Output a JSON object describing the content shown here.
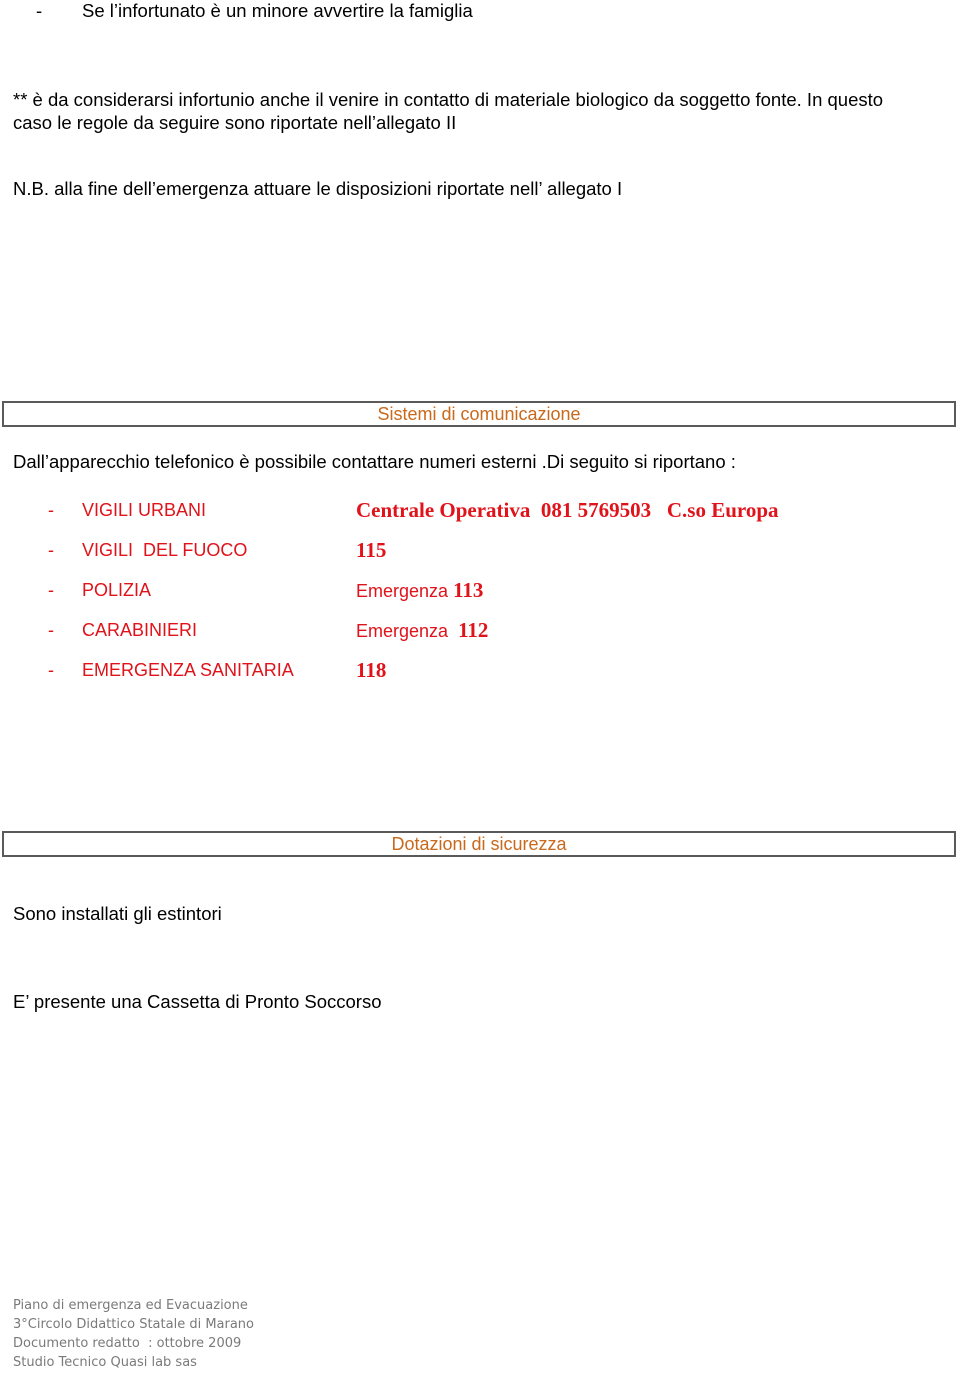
{
  "top_bullet": {
    "dash": "-",
    "text": "Se l’infortunato è un minore avvertire la famiglia"
  },
  "note_biological": {
    "line1": "** è da considerarsi infortunio anche il venire in contatto di materiale biologico da soggetto fonte. In questo",
    "line2": "caso le regole da seguire sono riportate nell’allegato II"
  },
  "nb_note": "N.B. alla fine dell’emergenza attuare le disposizioni riportate nell’ allegato I",
  "section_communication": {
    "title": "Sistemi di comunicazione",
    "intro": "Dall’apparecchio telefonico è possibile contattare numeri esterni .Di seguito si riportano  :",
    "contacts": [
      {
        "dash": "-",
        "name": "VIGILI URBANI",
        "prefix": "",
        "number": "Centrale Operativa  081 5769503   C.so Europa"
      },
      {
        "dash": "-",
        "name": "VIGILI  DEL FUOCO",
        "prefix": "",
        "number": "115"
      },
      {
        "dash": "-",
        "name": "POLIZIA",
        "prefix": "Emergenza ",
        "number": "113"
      },
      {
        "dash": "-",
        "name": "CARABINIERI",
        "prefix": "Emergenza  ",
        "number": "112"
      },
      {
        "dash": "-",
        "name": "EMERGENZA SANITARIA",
        "prefix": "",
        "number": "118"
      }
    ]
  },
  "section_safety": {
    "title": "Dotazioni di sicurezza",
    "items": [
      "Sono installati gli estintori",
      "E’ presente una Cassetta di Pronto Soccorso"
    ]
  },
  "footer": {
    "lines": [
      "Piano di emergenza ed Evacuazione",
      "3°Circolo Didattico Statale di Marano",
      "Documento redatto  : ottobre 2009",
      "Studio Tecnico Quasi lab sas"
    ]
  },
  "colors": {
    "section_title": "#c8691c",
    "contacts": "#e0121a",
    "footer": "#7a7a7a"
  }
}
